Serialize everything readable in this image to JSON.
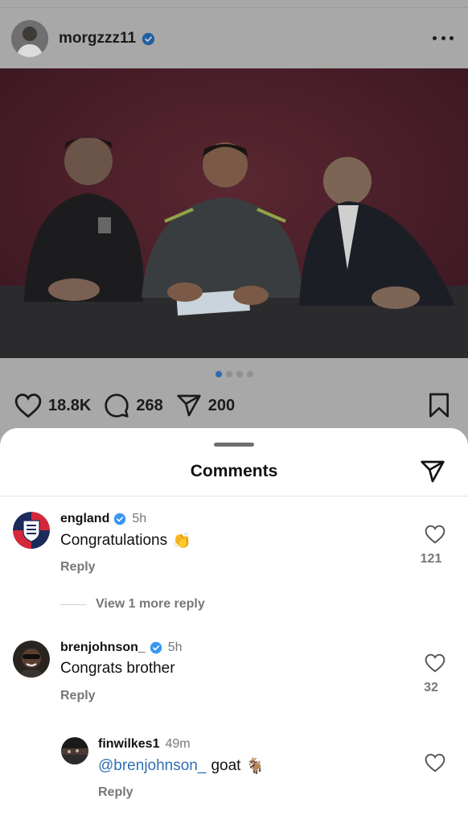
{
  "post": {
    "username": "morgzzz11",
    "verified": true,
    "carousel": {
      "count": 4,
      "active_index": 0
    },
    "stats": {
      "likes": "18.8K",
      "comments": "268",
      "shares": "200"
    },
    "icons": [
      "more-icon",
      "heart-icon",
      "comment-icon",
      "share-icon",
      "bookmark-icon"
    ]
  },
  "sheet": {
    "title": "Comments",
    "comments": [
      {
        "username": "england",
        "verified": true,
        "time": "5h",
        "text": "Congratulations",
        "emoji": "👏",
        "reply_label": "Reply",
        "likes": "121",
        "view_more": "View 1 more reply"
      },
      {
        "username": "brenjohnson_",
        "verified": true,
        "time": "5h",
        "text": "Congrats brother",
        "reply_label": "Reply",
        "likes": "32"
      }
    ],
    "reply": {
      "username": "finwilkes1",
      "time": "49m",
      "mention": "@brenjohnson_",
      "text": "goat",
      "emoji": "🐐",
      "reply_label": "Reply"
    }
  },
  "colors": {
    "accent_blue": "#2f6fb3",
    "verified_blue": "#3897f0",
    "dim_overlay": "#a8a8a8"
  }
}
